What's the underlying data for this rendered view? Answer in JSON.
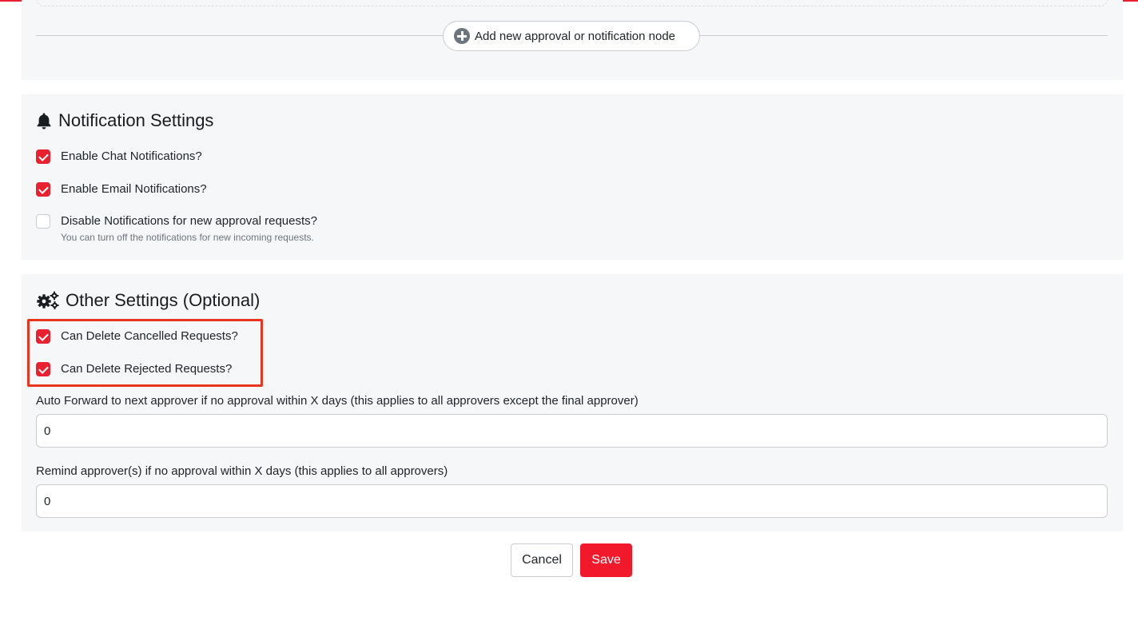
{
  "workflow": {
    "add_node_label": "Add new approval or notification node"
  },
  "notification_settings": {
    "title": "Notification Settings",
    "options": [
      {
        "label": "Enable Chat Notifications?",
        "checked": true
      },
      {
        "label": "Enable Email Notifications?",
        "checked": true
      },
      {
        "label": "Disable Notifications for new approval requests?",
        "checked": false,
        "help": "You can turn off the notifications for new incoming requests."
      }
    ]
  },
  "other_settings": {
    "title": "Other Settings (Optional)",
    "options": [
      {
        "label": "Can Delete Cancelled Requests?",
        "checked": true
      },
      {
        "label": "Can Delete Rejected Requests?",
        "checked": true
      }
    ],
    "auto_forward": {
      "label": "Auto Forward to next approver if no approval within X days (this applies to all approvers except the final approver)",
      "value": "0"
    },
    "remind": {
      "label": "Remind approver(s) if no approval within X days (this applies to all approvers)",
      "value": "0"
    }
  },
  "actions": {
    "cancel_label": "Cancel",
    "save_label": "Save"
  },
  "colors": {
    "accent": "#e8202f",
    "save_button": "#f2192d",
    "highlight_box": "#e8351f",
    "panel_bg": "#f6f7f9"
  },
  "icons": {
    "add_node": "plus-circle-icon",
    "notification_settings": "bell-icon",
    "other_settings": "gears-icon"
  }
}
